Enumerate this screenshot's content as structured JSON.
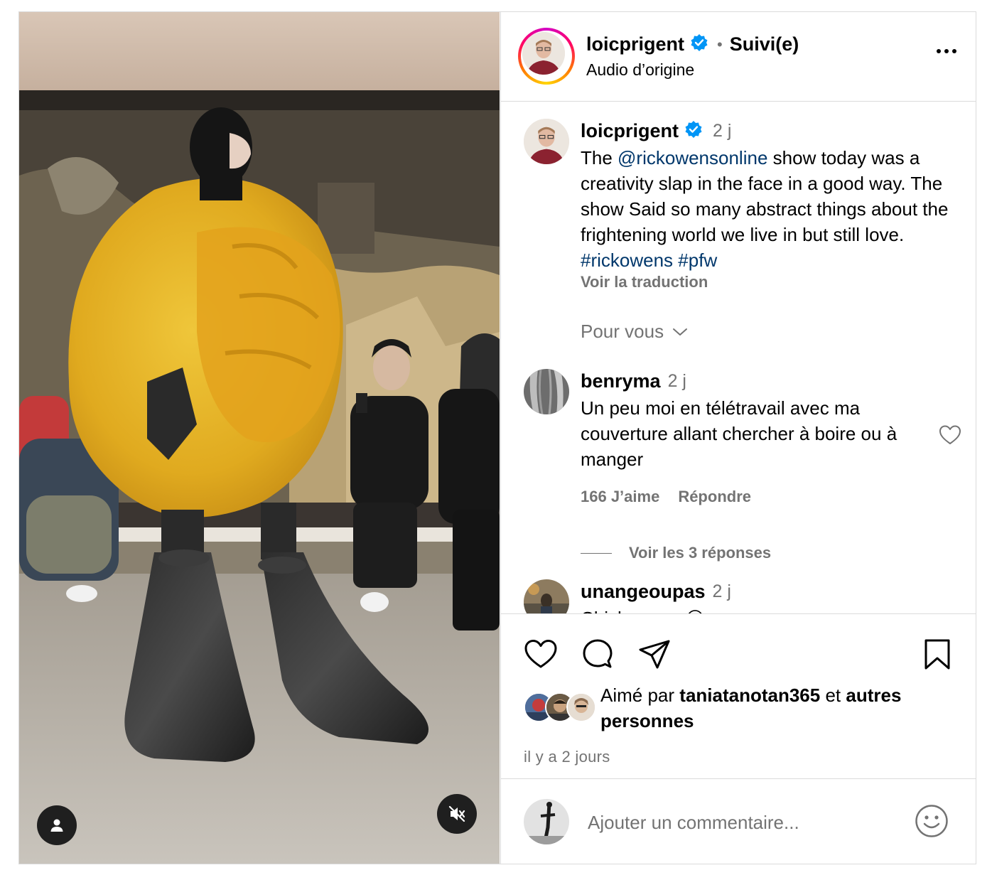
{
  "post": {
    "author": "loicprigent",
    "verified": true,
    "follow_state": "Suivi(e)",
    "separator": "•",
    "audio": "Audio d’origine"
  },
  "caption": {
    "author": "loicprigent",
    "time": "2 j",
    "text_before_mention": "The ",
    "mention": "@rickowensonline",
    "text_after_mention": " show today was a creativity slap in the face in a good way. The show Said so many abstract things about the frightening world we live in but still love. ",
    "hashtag_1": "#rickowens",
    "hashtag_2": "#pfw",
    "see_translation": "Voir la traduction"
  },
  "sort": {
    "label": "Pour vous"
  },
  "comments": [
    {
      "author": "benryma",
      "time": "2 j",
      "text": "Un peu moi en télétravail avec ma couverture allant chercher à boire ou à manger",
      "likes": "166 J’aime",
      "reply_label": "Répondre",
      "view_replies": "Voir les 3 réponses"
    },
    {
      "author": "unangeoupas",
      "time": "2 j",
      "text": "Chicken run 😂"
    }
  ],
  "likes": {
    "prefix": "Aimé par",
    "liker": "taniatanotan365",
    "middle": "et",
    "suffix": "autres personnes"
  },
  "posted_ago": "il y a 2 jours",
  "add_comment": {
    "placeholder": "Ajouter un commentaire..."
  },
  "colors": {
    "accent_link": "#00376b",
    "verified_blue": "#0095f6",
    "muted_text": "#737373",
    "border": "#dbdbdb",
    "coat_yellow": "#e8b62a"
  },
  "icons": {
    "like": "heart-icon",
    "comment": "comment-bubble-icon",
    "share": "paper-plane-icon",
    "save": "bookmark-icon",
    "emoji": "smiley-icon",
    "more": "ellipsis-icon",
    "tag": "user-tag-icon",
    "mute": "speaker-muted-icon"
  }
}
